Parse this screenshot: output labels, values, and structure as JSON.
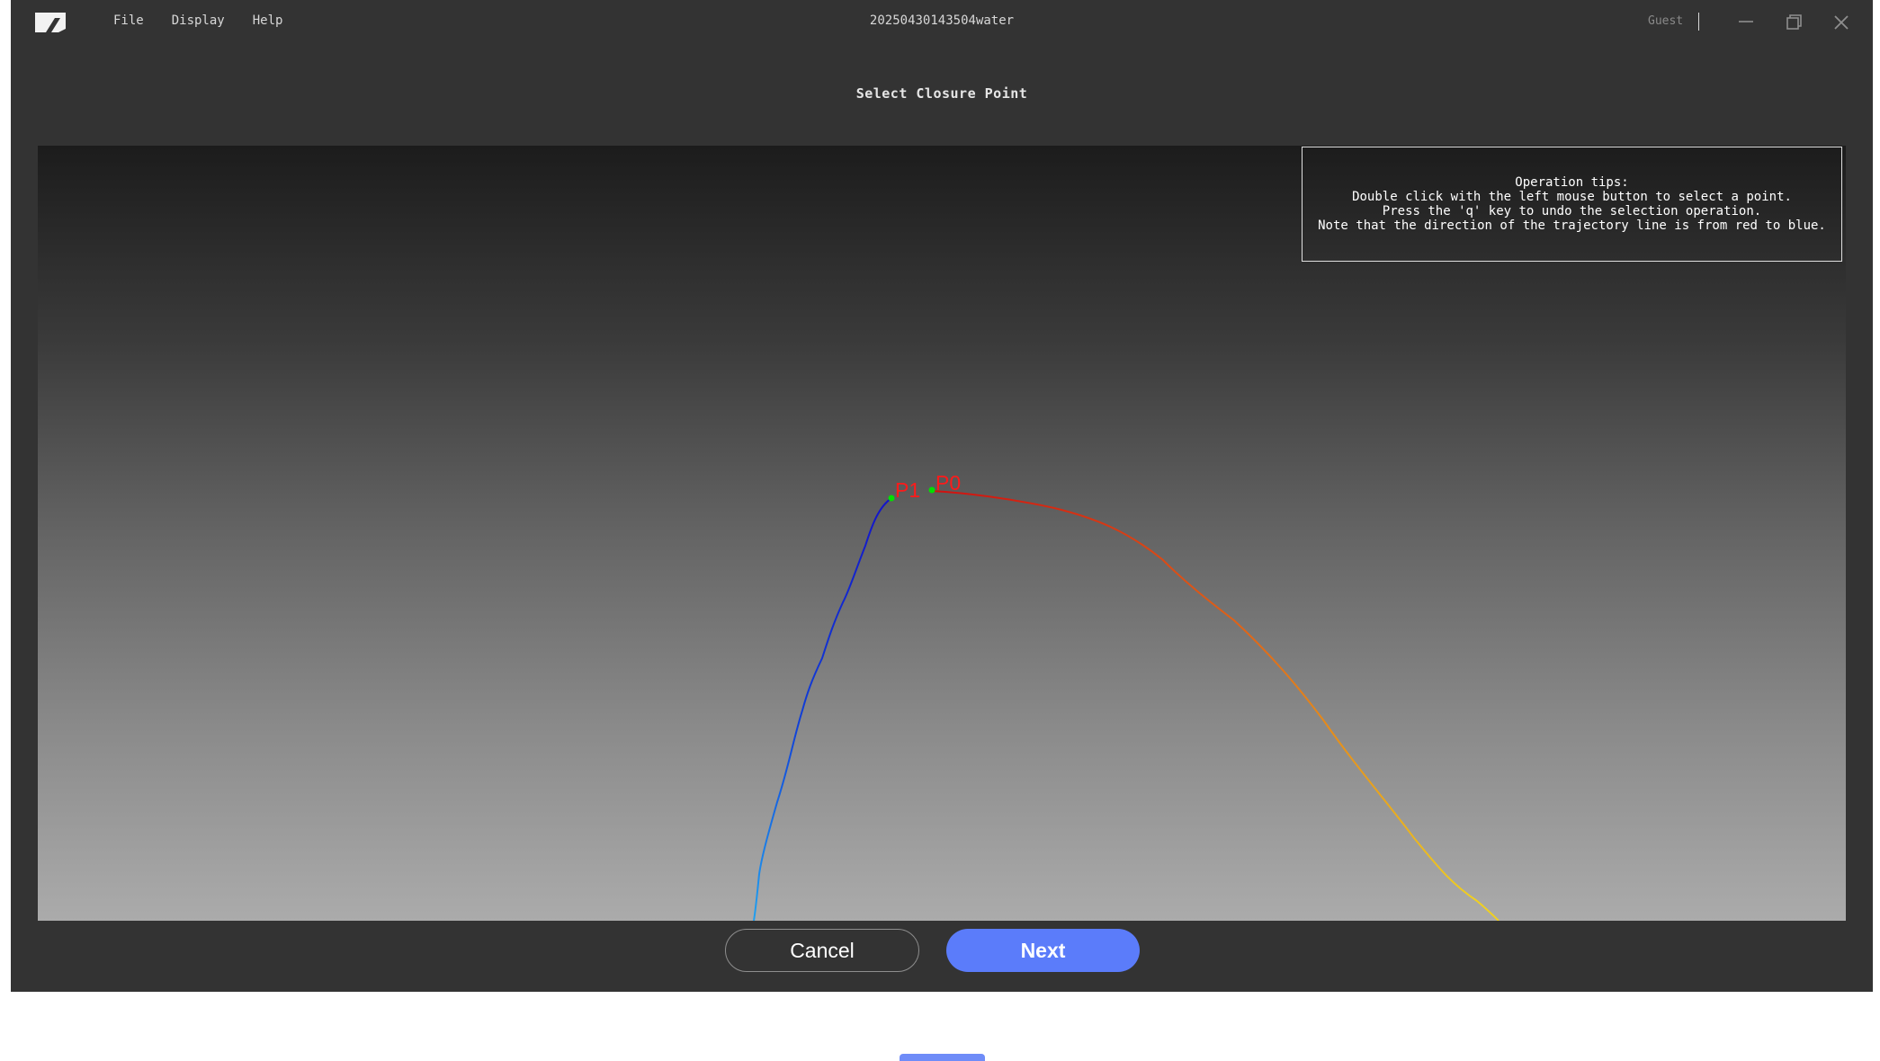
{
  "window": {
    "title": "20250430143504water",
    "menu": [
      "File",
      "Display",
      "Help"
    ],
    "user": "Guest"
  },
  "dialog": {
    "title": "Select Closure Point",
    "tips": [
      "Operation tips:",
      "Double click with the left mouse button to select a point.",
      "Press the 'q' key to undo the selection operation.",
      "Note that the direction of the trajectory line is from red to blue."
    ],
    "points": [
      {
        "label": "P0",
        "color": "#ff1a1a"
      },
      {
        "label": "P1",
        "color": "#ff1a1a"
      }
    ],
    "marker_color": "#00e000",
    "trajectory_colors": {
      "start": "#d01010",
      "middle": "#f0c020",
      "end": "#1010c8"
    }
  },
  "buttons": {
    "cancel": "Cancel",
    "next": "Next"
  },
  "colors": {
    "window_bg": "#333333",
    "accent": "#5b7cfa"
  },
  "icons": [
    "app-logo-icon",
    "minimize-icon",
    "restore-icon",
    "close-icon"
  ]
}
